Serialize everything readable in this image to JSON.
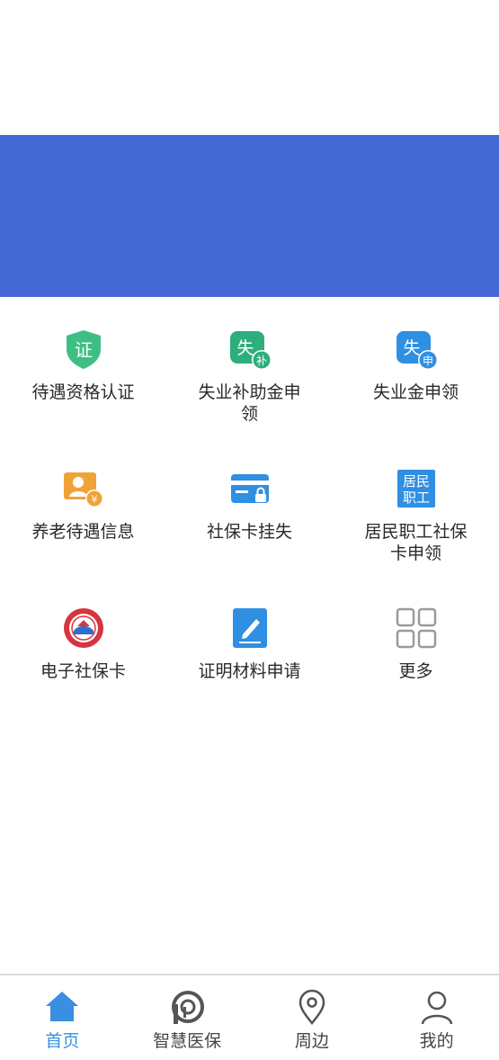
{
  "banner": {
    "color": "#4468d4"
  },
  "services": [
    {
      "label": "待遇资格认证",
      "icon": "shield-cert-icon",
      "glyph": "证"
    },
    {
      "label": "失业补助金申领",
      "icon": "unemployment-subsidy-icon",
      "glyph": "失",
      "badge": "补"
    },
    {
      "label": "失业金申领",
      "icon": "unemployment-benefit-icon",
      "glyph": "失",
      "badge": "申"
    },
    {
      "label": "养老待遇信息",
      "icon": "pension-info-icon"
    },
    {
      "label": "社保卡挂失",
      "icon": "card-lock-icon"
    },
    {
      "label": "居民职工社保卡申领",
      "icon": "resident-worker-card-icon",
      "glyph": "居民职工"
    },
    {
      "label": "电子社保卡",
      "icon": "social-security-emblem-icon"
    },
    {
      "label": "证明材料申请",
      "icon": "edit-document-icon"
    },
    {
      "label": "更多",
      "icon": "more-grid-icon"
    }
  ],
  "tabbar": {
    "items": [
      {
        "label": "首页",
        "icon": "home-icon",
        "active": true
      },
      {
        "label": "智慧医保",
        "icon": "medical-insurance-icon"
      },
      {
        "label": "周边",
        "icon": "location-pin-icon"
      },
      {
        "label": "我的",
        "icon": "user-icon"
      }
    ],
    "active_color": "#3a8fe0"
  }
}
